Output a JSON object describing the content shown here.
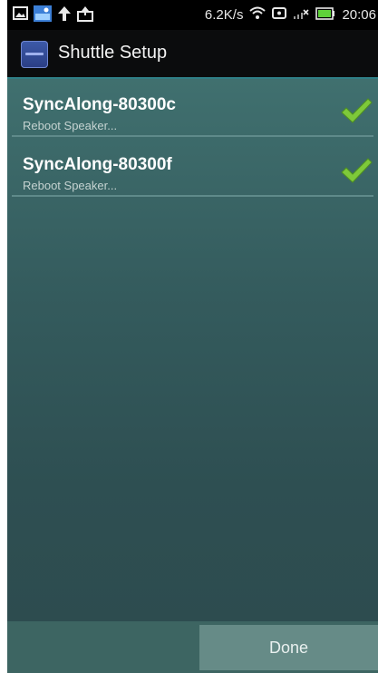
{
  "status_bar": {
    "net_speed": "6.2K/s",
    "time": "20:06",
    "icons": [
      "image-icon",
      "photo-app-icon",
      "upload-arrow-icon",
      "share-icon",
      "wifi-icon",
      "nfc-icon",
      "signal-icon",
      "battery-icon"
    ]
  },
  "action_bar": {
    "title": "Shuttle Setup",
    "app_icon": "syncalong-app-icon"
  },
  "devices": [
    {
      "name": "SyncAlong-80300c",
      "status": "Reboot Speaker...",
      "checked": true
    },
    {
      "name": "SyncAlong-80300f",
      "status": "Reboot Speaker...",
      "checked": true
    }
  ],
  "footer": {
    "done_label": "Done"
  },
  "colors": {
    "accent": "#2f7f86",
    "check_green": "#7ec93a",
    "content_bg": "#345b5d"
  }
}
